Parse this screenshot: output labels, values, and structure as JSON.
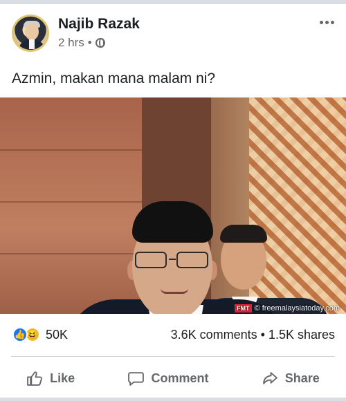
{
  "post": {
    "author": "Najib Razak",
    "time": "2 hrs",
    "separator": "•",
    "caption": "Azmin, makan mana malam ni?",
    "image_watermark": "© freemalaysiatoday.com",
    "watermark_logo": "FMT"
  },
  "stats": {
    "reaction_count": "50K",
    "engagement": "3.6K comments • 1.5K shares",
    "reaction_icons": [
      "like-icon",
      "haha-icon"
    ]
  },
  "actions": {
    "like": "Like",
    "comment": "Comment",
    "share": "Share"
  }
}
